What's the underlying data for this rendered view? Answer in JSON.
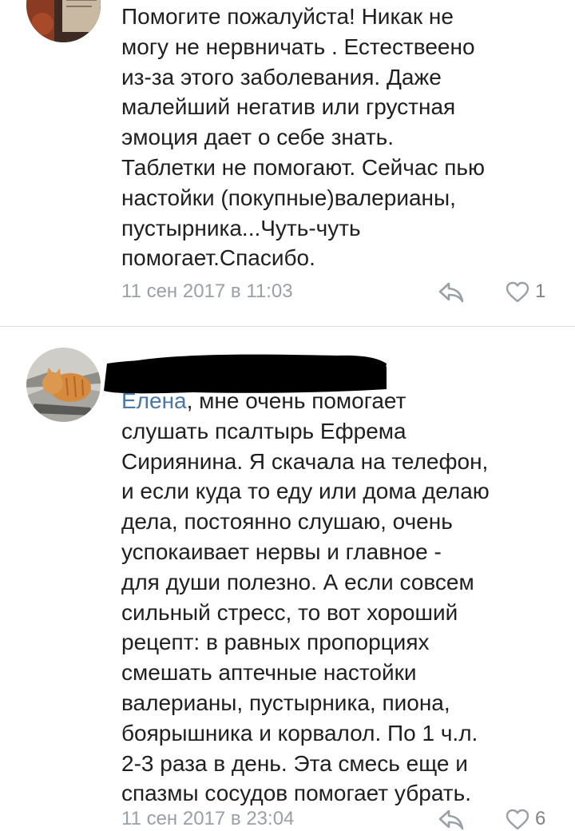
{
  "comments": [
    {
      "author_redacted": false,
      "avatar": "book-avatar",
      "text": "Помогите пожалуйста! Никак не\nмогу не нервничать . Естествеено\nиз-за этого заболевания. Даже\nмалейший негатив или грустная\nэмоция дает о себе знать.\nТаблетки не помогают. Сейчас пью\nнастойки (покупные)валерианы,\nпустырника...Чуть-чуть\nпомогает.Спасибо.",
      "timestamp": "11 сен 2017 в 11:03",
      "likes": "1",
      "reply_icon": "reply-icon",
      "like_icon": "heart-outline-icon"
    },
    {
      "author_redacted": true,
      "avatar": "cat-avatar",
      "mention": "Елена",
      "text": ", мне очень помогает\nслушать псалтырь Ефрема\nСириянина. Я скачала на телефон,\nи если куда то еду или дома делаю\nдела, постоянно слушаю, очень\nуспокаивает нервы и главное -\nдля души полезно. А если совсем\nсильный стресс, то вот хороший\nрецепт: в равных пропорциях\nсмешать аптечные настойки\nвалерианы, пустырника, пиона,\nбоярышника и корвалол. По 1 ч.л.\n2-3 раза в день. Эта смесь еще и\nспазмы сосудов помогает убрать.",
      "timestamp": "11 сен 2017 в 23:04",
      "likes": "6",
      "reply_icon": "reply-icon",
      "like_icon": "heart-outline-icon"
    }
  ],
  "colors": {
    "text": "#1f1f1f",
    "meta": "#9aa0a6",
    "mention": "#4a76a8",
    "divider": "#dcdcdc"
  }
}
